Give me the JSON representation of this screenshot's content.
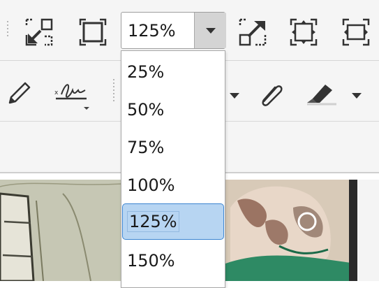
{
  "zoom": {
    "current": "125%",
    "options": [
      "25%",
      "50%",
      "75%",
      "100%",
      "125%",
      "150%"
    ],
    "selected_index": 4
  },
  "icons": {
    "toolbar_row1": [
      "fit-page-icon",
      "full-screen-icon",
      "open-external-icon",
      "fit-height-icon",
      "fit-width-icon"
    ],
    "toolbar_row2": [
      "pencil-icon",
      "signature-icon",
      "paperclip-icon",
      "highlighter-icon"
    ]
  },
  "colors": {
    "selected_bg": "#b7d5f2",
    "selected_border": "#3b84d0",
    "toolbar_bg": "#f5f5f5"
  }
}
